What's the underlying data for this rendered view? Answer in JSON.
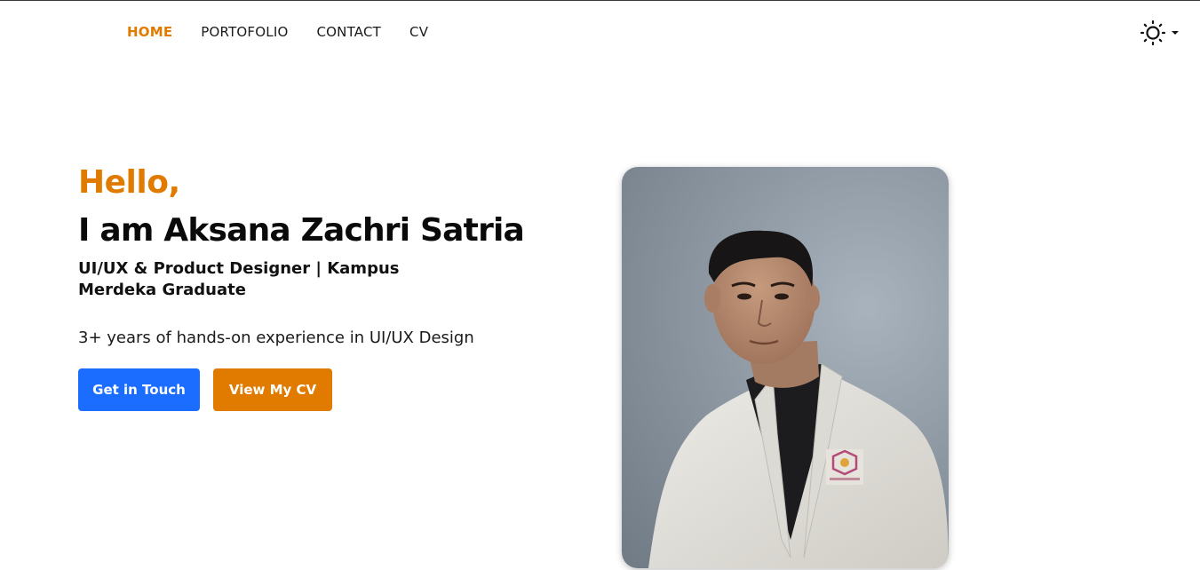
{
  "nav": {
    "items": [
      {
        "label": "HOME",
        "active": true
      },
      {
        "label": "PORTOFOLIO",
        "active": false
      },
      {
        "label": "CONTACT",
        "active": false
      },
      {
        "label": "CV",
        "active": false
      }
    ],
    "theme_toggle_icon": "sun-icon"
  },
  "hero": {
    "greeting": "Hello,",
    "name": "I am Aksana Zachri Satria",
    "role": "UI/UX & Product Designer | Kampus Merdeka Graduate",
    "experience": "3+ years of hands-on experience in UI/UX Design",
    "primary_button": "Get in Touch",
    "secondary_button": "View My CV"
  },
  "photo": {
    "subject": "portrait-photo"
  },
  "colors": {
    "accent_orange": "#e07b00",
    "accent_blue": "#1a6dff",
    "text_dark": "#0a0a0a"
  }
}
